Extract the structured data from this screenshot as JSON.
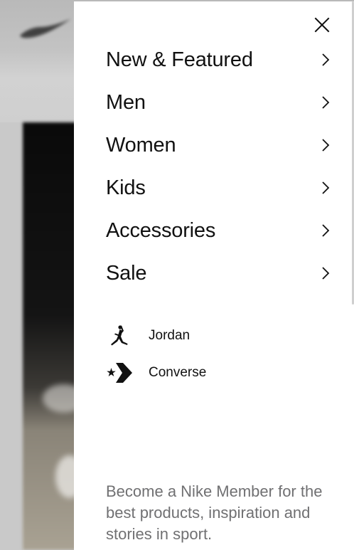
{
  "menu": {
    "items": [
      {
        "label": "New & Featured",
        "icon": "chevron-right-icon"
      },
      {
        "label": "Men",
        "icon": "chevron-right-icon"
      },
      {
        "label": "Women",
        "icon": "chevron-right-icon"
      },
      {
        "label": "Kids",
        "icon": "chevron-right-icon"
      },
      {
        "label": "Accessories",
        "icon": "chevron-right-icon"
      },
      {
        "label": "Sale",
        "icon": "chevron-right-icon"
      }
    ]
  },
  "brands": {
    "items": [
      {
        "label": "Jordan",
        "icon": "jordan-jumpman-logo"
      },
      {
        "label": "Converse",
        "icon": "converse-star-chevron-logo"
      }
    ]
  },
  "member": {
    "pitch": "Become a Nike Member for the best products, inspiration and stories in sport."
  },
  "icons": {
    "close": "close-icon"
  },
  "colors": {
    "text_primary": "#111111",
    "text_secondary": "#707072",
    "drawer_background": "#ffffff",
    "overlay": "#bdbdbd"
  }
}
